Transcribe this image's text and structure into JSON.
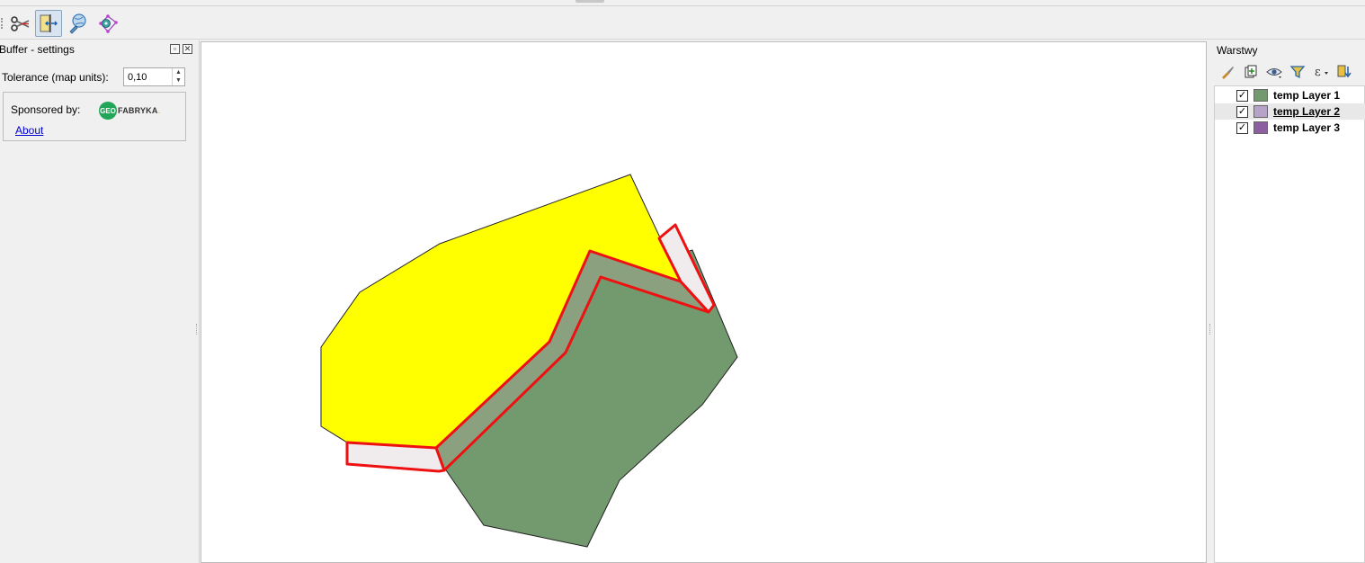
{
  "toolbar": {
    "tools": [
      {
        "name": "scissors-icon"
      },
      {
        "name": "split-buffer-icon",
        "active": true
      },
      {
        "name": "globe-edit-icon"
      },
      {
        "name": "vertex-tool-icon"
      }
    ]
  },
  "left_panel": {
    "title": "Buffer - settings",
    "tolerance_label": "Tolerance (map units):",
    "tolerance_value": "0,10",
    "sponsored_label": "Sponsored by:",
    "logo_text": {
      "circle": "GEO",
      "word": "FABRYKA",
      "dot": "."
    },
    "about_link": "About"
  },
  "right_panel": {
    "title": "Warstwy",
    "tools": [
      "brush-icon",
      "add-group-icon",
      "eye-icon",
      "filter-icon",
      "expression-icon",
      "move-down-icon"
    ],
    "layers": [
      {
        "name": "temp Layer 1",
        "checked": true,
        "color": "#739a6e",
        "selected": false
      },
      {
        "name": "temp Layer 2",
        "checked": true,
        "color": "#b8a3c8",
        "selected": true
      },
      {
        "name": "temp Layer 3",
        "checked": true,
        "color": "#8e5ea2",
        "selected": false
      }
    ]
  },
  "map": {
    "colors": {
      "yellow_fill": "#ffff00",
      "green_fill": "#739a6e",
      "buffer_fill": "#f0ecee",
      "buffer_stroke": "#ee1111",
      "overlap_fill": "#8ba07f"
    }
  }
}
